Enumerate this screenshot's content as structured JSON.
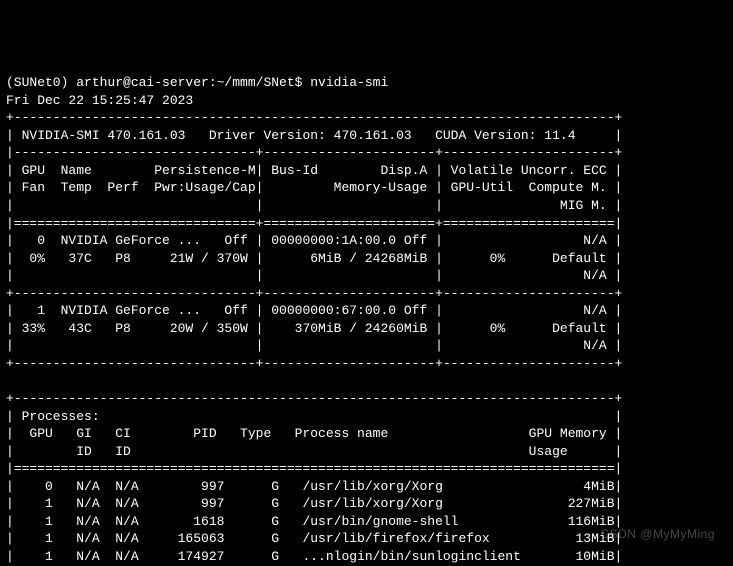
{
  "prompt": "(SUNet0) arthur@cai-server:~/mmm/SNet$ ",
  "command": "nvidia-smi",
  "timestamp": "Fri Dec 22 15:25:47 2023",
  "header": {
    "smi_label": "NVIDIA-SMI",
    "smi_version": "470.161.03",
    "driver_label": "Driver Version:",
    "driver_version": "470.161.03",
    "cuda_label": "CUDA Version:",
    "cuda_version": "11.4"
  },
  "col_headers": {
    "c1l1": "GPU  Name        Persistence-M",
    "c2l1": "Bus-Id        Disp.A",
    "c3l1": "Volatile Uncorr. ECC",
    "c1l2": "Fan  Temp  Perf  Pwr:Usage/Cap",
    "c2l2": "        Memory-Usage",
    "c3l2": "GPU-Util  Compute M.",
    "c3l3": "              MIG M."
  },
  "gpus": [
    {
      "idx": "0",
      "name": "NVIDIA GeForce ...",
      "persist": "Off",
      "bus": "00000000:1A:00.0",
      "dispa": "Off",
      "ecc": "N/A",
      "fan": "0%",
      "temp": "37C",
      "perf": "P8",
      "pwr": "21W / 370W",
      "mem": "6MiB / 24268MiB",
      "util": "0%",
      "compute": "Default",
      "mig": "N/A"
    },
    {
      "idx": "1",
      "name": "NVIDIA GeForce ...",
      "persist": "Off",
      "bus": "00000000:67:00.0",
      "dispa": "Off",
      "ecc": "N/A",
      "fan": "33%",
      "temp": "43C",
      "perf": "P8",
      "pwr": "20W / 350W",
      "mem": "370MiB / 24260MiB",
      "util": "0%",
      "compute": "Default",
      "mig": "N/A"
    }
  ],
  "proc_header": {
    "title": "Processes:",
    "l1": "GPU   GI   CI        PID   Type   Process name                  GPU Memory",
    "l2": "      ID   ID                                                   Usage     "
  },
  "processes": [
    {
      "gpu": "0",
      "gi": "N/A",
      "ci": "N/A",
      "pid": "997",
      "type": "G",
      "name": "/usr/lib/xorg/Xorg",
      "mem": "4MiB"
    },
    {
      "gpu": "1",
      "gi": "N/A",
      "ci": "N/A",
      "pid": "997",
      "type": "G",
      "name": "/usr/lib/xorg/Xorg",
      "mem": "227MiB"
    },
    {
      "gpu": "1",
      "gi": "N/A",
      "ci": "N/A",
      "pid": "1618",
      "type": "G",
      "name": "/usr/bin/gnome-shell",
      "mem": "116MiB"
    },
    {
      "gpu": "1",
      "gi": "N/A",
      "ci": "N/A",
      "pid": "165063",
      "type": "G",
      "name": "/usr/lib/firefox/firefox",
      "mem": "13MiB"
    },
    {
      "gpu": "1",
      "gi": "N/A",
      "ci": "N/A",
      "pid": "174927",
      "type": "G",
      "name": "...nlogin/bin/sunloginclient",
      "mem": "10MiB"
    }
  ],
  "border": {
    "top": "+-----------------------------------------------------------------------------+",
    "sep3": "|-------------------------------+----------------------+----------------------+",
    "eq3": "|===============================+======================+======================|",
    "dash3": "+-------------------------------+----------------------+----------------------+",
    "eq1": "|=============================================================================|",
    "blank3": "|                               |                      |                      |"
  },
  "watermark": "CSDN @MyMyMing"
}
